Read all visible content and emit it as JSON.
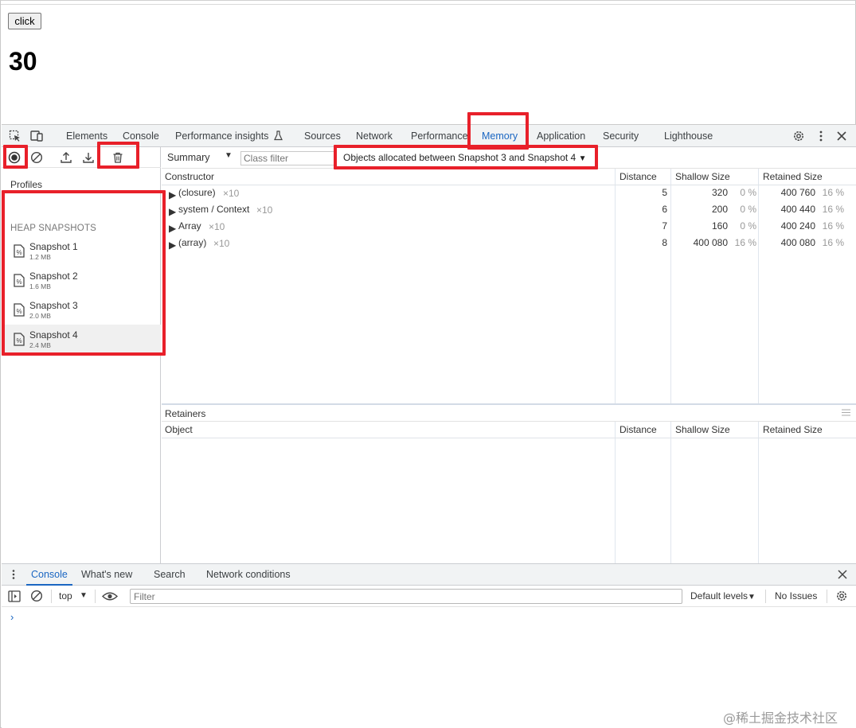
{
  "page": {
    "button_label": "click",
    "counter_value": "30"
  },
  "devtools": {
    "tabs": [
      {
        "label": "Elements"
      },
      {
        "label": "Console"
      },
      {
        "label": "Performance insights"
      },
      {
        "label": "Sources"
      },
      {
        "label": "Network"
      },
      {
        "label": "Performance"
      },
      {
        "label": "Memory",
        "active": true
      },
      {
        "label": "Application"
      },
      {
        "label": "Security"
      },
      {
        "label": "Lighthouse"
      }
    ],
    "profiles_label": "Profiles",
    "heap_snapshots_title": "HEAP SNAPSHOTS",
    "snapshots": [
      {
        "name": "Snapshot 1",
        "size": "1.2 MB"
      },
      {
        "name": "Snapshot 2",
        "size": "1.6 MB"
      },
      {
        "name": "Snapshot 3",
        "size": "2.0 MB"
      },
      {
        "name": "Snapshot 4",
        "size": "2.4 MB",
        "selected": true
      }
    ],
    "view_select": "Summary",
    "class_filter_placeholder": "Class filter",
    "objects_select": "Objects allocated between Snapshot 3 and Snapshot 4",
    "columns": {
      "constructor": "Constructor",
      "distance": "Distance",
      "shallow_size": "Shallow Size",
      "retained_size": "Retained Size"
    },
    "rows": [
      {
        "name": "(closure)",
        "count": "×10",
        "distance": "5",
        "shallow": "320",
        "shallow_pct": "0 %",
        "retained": "400 760",
        "retained_pct": "16 %"
      },
      {
        "name": "system / Context",
        "count": "×10",
        "distance": "6",
        "shallow": "200",
        "shallow_pct": "0 %",
        "retained": "400 440",
        "retained_pct": "16 %"
      },
      {
        "name": "Array",
        "count": "×10",
        "distance": "7",
        "shallow": "160",
        "shallow_pct": "0 %",
        "retained": "400 240",
        "retained_pct": "16 %"
      },
      {
        "name": "(array)",
        "count": "×10",
        "distance": "8",
        "shallow": "400 080",
        "shallow_pct": "16 %",
        "retained": "400 080",
        "retained_pct": "16 %"
      }
    ],
    "retainers": {
      "title": "Retainers",
      "columns": {
        "object": "Object",
        "distance": "Distance",
        "shallow_size": "Shallow Size",
        "retained_size": "Retained Size"
      }
    }
  },
  "drawer": {
    "tabs": [
      {
        "label": "Console",
        "active": true
      },
      {
        "label": "What's new"
      },
      {
        "label": "Search"
      },
      {
        "label": "Network conditions"
      }
    ],
    "context": "top",
    "filter_placeholder": "Filter",
    "levels": "Default levels",
    "issues": "No Issues",
    "prompt": "›"
  },
  "watermark": "@稀土掘金技术社区",
  "colors": {
    "accent": "#1a66c2",
    "highlight": "#e8202a"
  }
}
